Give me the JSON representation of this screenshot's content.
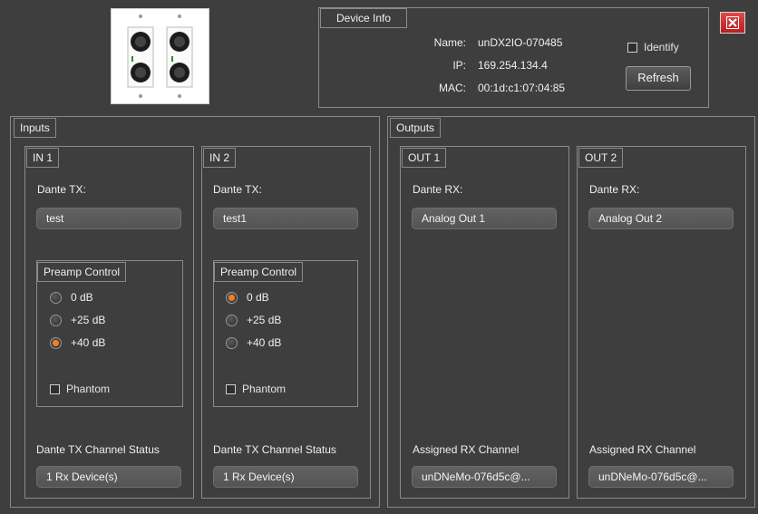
{
  "device_info": {
    "title": "Device Info",
    "name_label": "Name:",
    "name_value": "unDX2IO-070485",
    "ip_label": "IP:",
    "ip_value": "169.254.134.4",
    "mac_label": "MAC:",
    "mac_value": "00:1d:c1:07:04:85",
    "identify_label": "Identify",
    "refresh_label": "Refresh"
  },
  "inputs": {
    "title": "Inputs",
    "channels": [
      {
        "title": "IN 1",
        "dante_tx_label": "Dante TX:",
        "dante_tx_value": "test",
        "preamp_title": "Preamp Control",
        "options": [
          "0 dB",
          "+25 dB",
          "+40 dB"
        ],
        "selected": "+40 dB",
        "phantom_label": "Phantom",
        "status_label": "Dante TX Channel Status",
        "status_value": "1 Rx Device(s)"
      },
      {
        "title": "IN 2",
        "dante_tx_label": "Dante TX:",
        "dante_tx_value": "test1",
        "preamp_title": "Preamp Control",
        "options": [
          "0 dB",
          "+25 dB",
          "+40 dB"
        ],
        "selected": "0 dB",
        "phantom_label": "Phantom",
        "status_label": "Dante TX Channel Status",
        "status_value": "1 Rx Device(s)"
      }
    ]
  },
  "outputs": {
    "title": "Outputs",
    "channels": [
      {
        "title": "OUT 1",
        "dante_rx_label": "Dante RX:",
        "dante_rx_value": "Analog Out 1",
        "assigned_label": "Assigned RX Channel",
        "assigned_value": "unDNeMo-076d5c@..."
      },
      {
        "title": "OUT 2",
        "dante_rx_label": "Dante RX:",
        "dante_rx_value": "Analog Out 2",
        "assigned_label": "Assigned RX Channel",
        "assigned_value": "unDNeMo-076d5c@..."
      }
    ]
  },
  "colors": {
    "background": "#3e3e3e",
    "accent_radio": "#ff7d16",
    "close_button": "#c62828"
  }
}
